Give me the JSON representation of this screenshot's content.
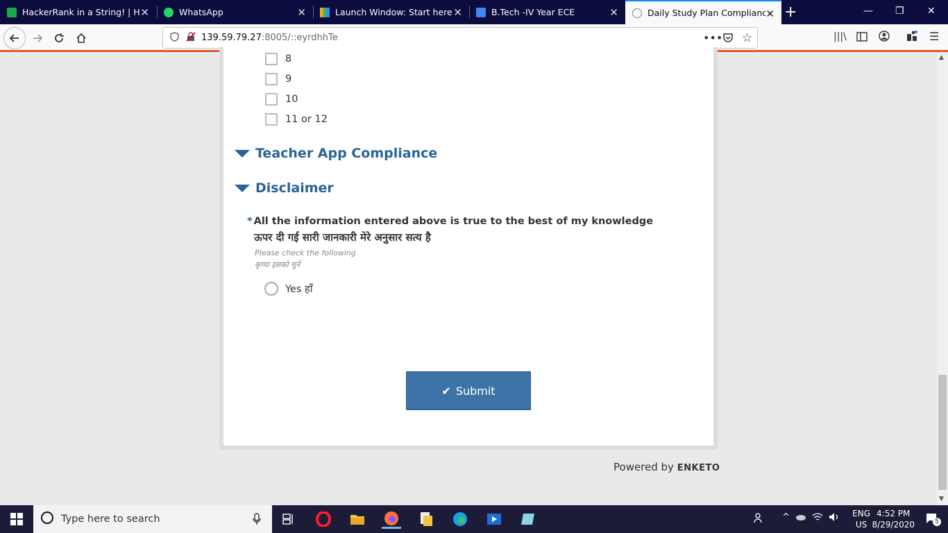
{
  "browser": {
    "tabs": [
      {
        "title": "HackerRank in a String! | Hacke"
      },
      {
        "title": "WhatsApp"
      },
      {
        "title": "Launch Window: Start here"
      },
      {
        "title": "B.Tech -IV Year ECE"
      },
      {
        "title": "Daily Study Plan Compliance Fo"
      }
    ],
    "url_host": "139.59.79.27",
    "url_path": ":8005/::eyrdhhTe"
  },
  "form": {
    "options": [
      "8",
      "9",
      "10",
      "11 or 12"
    ],
    "sections": {
      "teacher": "Teacher App Compliance",
      "disclaimer": "Disclaimer"
    },
    "question": {
      "required_mark": "*",
      "label_en": "All the information entered above is true to the best of my knowledge",
      "label_hi": "ऊपर दी गई सारी जानकारी मेरे अनुसार सत्य है",
      "hint_en": "Please check the following",
      "hint_hi": "कृप्या इसको चुनें",
      "option": "Yes हाँ"
    },
    "submit_label": "Submit",
    "powered_by": "Powered by",
    "brand": "ENKETO"
  },
  "taskbar": {
    "search_placeholder": "Type here to search",
    "lang": "ENG",
    "region": "US",
    "time": "4:52 PM",
    "date": "8/29/2020",
    "notifications": "5"
  }
}
